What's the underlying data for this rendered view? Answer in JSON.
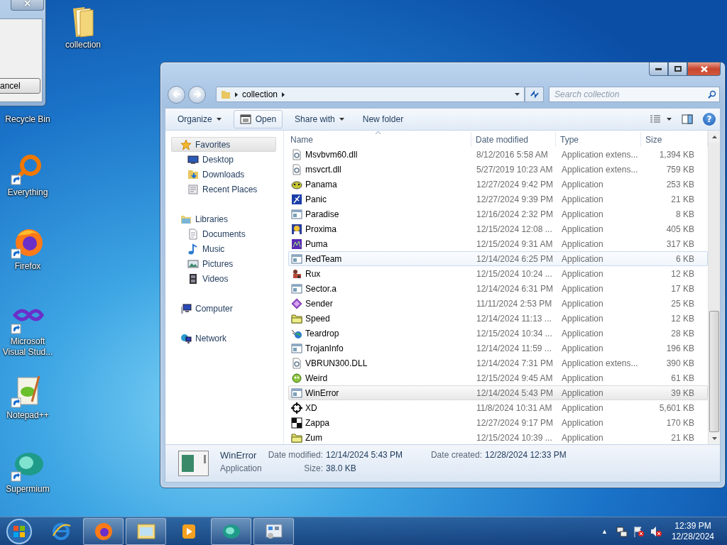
{
  "dialog": {
    "close": "×",
    "button": "ancel"
  },
  "desktop_icons": [
    {
      "label": "collection",
      "kind": "folder"
    },
    {
      "label": "Recycle Bin",
      "kind": "covered"
    },
    {
      "label": "Everything",
      "kind": "ring"
    },
    {
      "label": "Firefox",
      "kind": "fox"
    },
    {
      "label": "Microsoft Visual Stud...",
      "kind": "loop"
    },
    {
      "label": "Notepad++",
      "kind": "notepad"
    },
    {
      "label": "Supermium",
      "kind": "orb"
    }
  ],
  "explorer": {
    "address": {
      "crumb": "collection"
    },
    "search": {
      "placeholder": "Search collection"
    },
    "toolbar": [
      {
        "label": "Organize",
        "kind": "menu"
      },
      {
        "label": "Open",
        "kind": "open"
      },
      {
        "label": "Share with",
        "kind": "menu"
      },
      {
        "label": "New folder",
        "kind": "plain"
      }
    ],
    "help": "?",
    "nav_pane": [
      {
        "label": "Favorites",
        "kind": "star",
        "selected": true,
        "children": [
          {
            "label": "Desktop",
            "kind": "desktop",
            "selected": false
          },
          {
            "label": "Downloads",
            "kind": "downloads",
            "selected": false
          },
          {
            "label": "Recent Places",
            "kind": "recent",
            "selected": false
          }
        ]
      },
      {
        "label": "Libraries",
        "kind": "libraries",
        "selected": false,
        "children": [
          {
            "label": "Documents",
            "kind": "documents",
            "selected": false
          },
          {
            "label": "Music",
            "kind": "music",
            "selected": false
          },
          {
            "label": "Pictures",
            "kind": "pictures",
            "selected": false
          },
          {
            "label": "Videos",
            "kind": "videos",
            "selected": false
          }
        ]
      },
      {
        "label": "Computer",
        "kind": "computer",
        "selected": false
      },
      {
        "label": "Network",
        "kind": "network",
        "selected": false
      }
    ],
    "columns": [
      "Name",
      "Date modified",
      "Type",
      "Size"
    ],
    "rows": [
      {
        "name": "Msvbvm60.dll",
        "date": "8/12/2016 5:58 AM",
        "type": "Application extens...",
        "size": "1,394 KB",
        "kind": "dll",
        "selected": false,
        "hovered": false
      },
      {
        "name": "msvcrt.dll",
        "date": "5/27/2019 10:23 AM",
        "type": "Application extens...",
        "size": "759 KB",
        "kind": "dll",
        "selected": false,
        "hovered": false
      },
      {
        "name": "Panama",
        "date": "12/27/2024 9:42 PM",
        "type": "Application",
        "size": "253 KB",
        "kind": "panama",
        "selected": false,
        "hovered": false
      },
      {
        "name": "Panic",
        "date": "12/27/2024 9:39 PM",
        "type": "Application",
        "size": "21 KB",
        "kind": "panic",
        "selected": false,
        "hovered": false
      },
      {
        "name": "Paradise",
        "date": "12/16/2024 2:32 PM",
        "type": "Application",
        "size": "8 KB",
        "kind": "window",
        "selected": false,
        "hovered": false
      },
      {
        "name": "Proxima",
        "date": "12/15/2024 12:08 ...",
        "type": "Application",
        "size": "405 KB",
        "kind": "proxima",
        "selected": false,
        "hovered": false
      },
      {
        "name": "Puma",
        "date": "12/15/2024 9:31 AM",
        "type": "Application",
        "size": "317 KB",
        "kind": "puma",
        "selected": false,
        "hovered": false
      },
      {
        "name": "RedTeam",
        "date": "12/14/2024 6:25 PM",
        "type": "Application",
        "size": "6 KB",
        "kind": "window",
        "selected": false,
        "hovered": true
      },
      {
        "name": "Rux",
        "date": "12/15/2024 10:24 ...",
        "type": "Application",
        "size": "12 KB",
        "kind": "rux",
        "selected": false,
        "hovered": false
      },
      {
        "name": "Sector.a",
        "date": "12/14/2024 6:31 PM",
        "type": "Application",
        "size": "17 KB",
        "kind": "window",
        "selected": false,
        "hovered": false
      },
      {
        "name": "Sender",
        "date": "11/11/2024 2:53 PM",
        "type": "Application",
        "size": "25 KB",
        "kind": "sender",
        "selected": false,
        "hovered": false
      },
      {
        "name": "Speed",
        "date": "12/14/2024 11:13 ...",
        "type": "Application",
        "size": "12 KB",
        "kind": "folder",
        "selected": false,
        "hovered": false
      },
      {
        "name": "Teardrop",
        "date": "12/15/2024 10:34 ...",
        "type": "Application",
        "size": "28 KB",
        "kind": "teardrop",
        "selected": false,
        "hovered": false
      },
      {
        "name": "TrojanInfo",
        "date": "12/14/2024 11:59 ...",
        "type": "Application",
        "size": "196 KB",
        "kind": "window",
        "selected": false,
        "hovered": false
      },
      {
        "name": "VBRUN300.DLL",
        "date": "12/14/2024 7:31 PM",
        "type": "Application extens...",
        "size": "390 KB",
        "kind": "dll",
        "selected": false,
        "hovered": false
      },
      {
        "name": "Weird",
        "date": "12/15/2024 9:45 AM",
        "type": "Application",
        "size": "61 KB",
        "kind": "weird",
        "selected": false,
        "hovered": false
      },
      {
        "name": "WinError",
        "date": "12/14/2024 5:43 PM",
        "type": "Application",
        "size": "39 KB",
        "kind": "window",
        "selected": true,
        "hovered": false
      },
      {
        "name": "XD",
        "date": "11/8/2024 10:31 AM",
        "type": "Application",
        "size": "5,601 KB",
        "kind": "xd",
        "selected": false,
        "hovered": false
      },
      {
        "name": "Zappa",
        "date": "12/27/2024 9:17 PM",
        "type": "Application",
        "size": "170 KB",
        "kind": "zappa",
        "selected": false,
        "hovered": false
      },
      {
        "name": "Zum",
        "date": "12/15/2024 10:39 ...",
        "type": "Application",
        "size": "21 KB",
        "kind": "folder",
        "selected": false,
        "hovered": false
      }
    ],
    "details": {
      "name": "WinError",
      "type": "Application",
      "fields": [
        {
          "label": "Date modified:",
          "value": "12/14/2024 5:43 PM"
        },
        {
          "label": "Size:",
          "value": "38.0 KB"
        },
        {
          "label": "Date created:",
          "value": "12/28/2024 12:33 PM"
        }
      ]
    }
  },
  "taskbar": {
    "apps": [
      {
        "kind": "browser",
        "running": false
      },
      {
        "kind": "fox",
        "running": true
      },
      {
        "kind": "explorer",
        "running": true
      },
      {
        "kind": "media",
        "running": false
      },
      {
        "kind": "orb",
        "running": true
      },
      {
        "kind": "panel",
        "running": true
      }
    ],
    "show_hidden": "▲",
    "time": "12:39 PM",
    "date": "12/28/2024"
  }
}
